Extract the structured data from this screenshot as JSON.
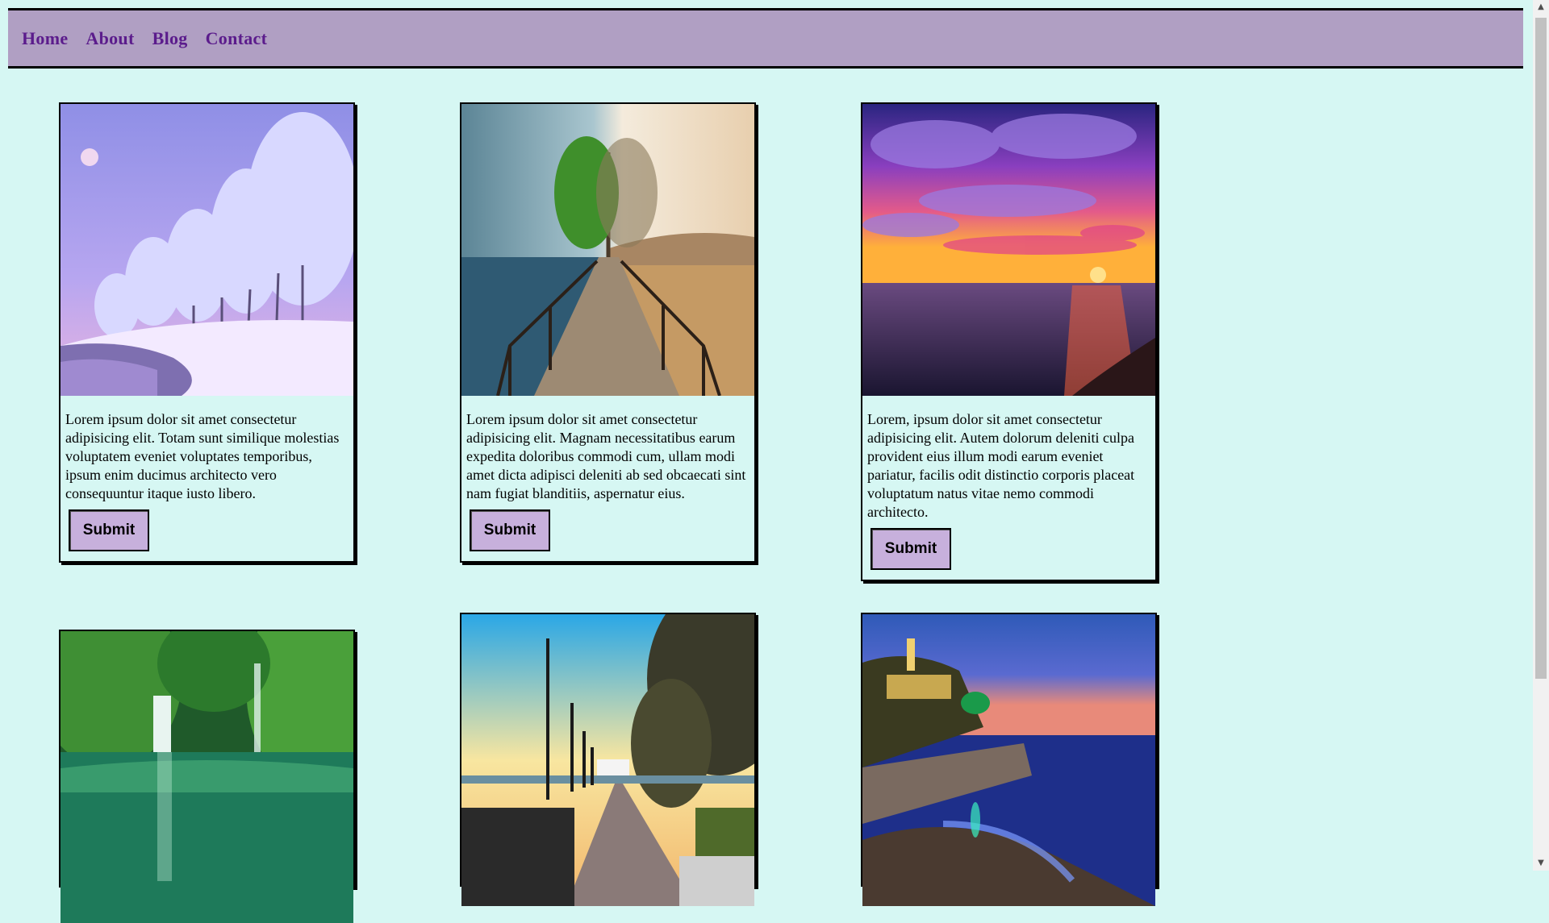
{
  "nav": {
    "items": [
      {
        "label": "Home"
      },
      {
        "label": "About"
      },
      {
        "label": "Blog"
      },
      {
        "label": "Contact"
      }
    ]
  },
  "cards": [
    {
      "text": "Lorem ipsum dolor sit amet consectetur adipisicing elit. Totam sunt similique molestias voluptatem eveniet voluptates temporibus, ipsum enim ducimus architecto vero consequuntur itaque iusto libero.",
      "button": "Submit",
      "image": "snowy-trees-image"
    },
    {
      "text": "Lorem ipsum dolor sit amet consectetur adipisicing elit. Magnam necessitatibus earum expedita doloribus commodi cum, ullam modi amet dicta adipisci deleniti ab sed obcaecati sint nam fugiat blanditiis, aspernatur eius.",
      "button": "Submit",
      "image": "pier-tree-image"
    },
    {
      "text": "Lorem, ipsum dolor sit amet consectetur adipisicing elit. Autem dolorum deleniti culpa provident eius illum modi earum eveniet pariatur, facilis odit distinctio corporis placeat voluptatum natus vitae nemo commodi architecto.",
      "button": "Submit",
      "image": "sunset-sea-image"
    },
    {
      "image": "waterfall-forest-image"
    },
    {
      "image": "promenade-lamps-image"
    },
    {
      "image": "coastal-town-image"
    }
  ],
  "colors": {
    "background": "#d6f7f3",
    "navbar": "#b09fc3",
    "nav_link": "#5b1c8c",
    "button": "#c7b0dc"
  }
}
